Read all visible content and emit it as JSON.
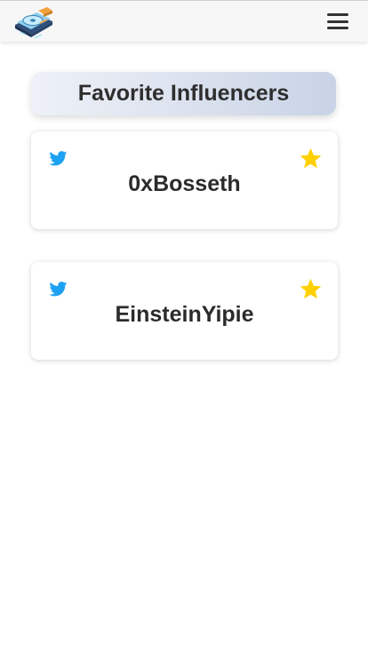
{
  "header": {
    "logo_icon": "harddrive-logo-icon",
    "menu_icon": "hamburger-menu-icon"
  },
  "main": {
    "title": "Favorite Influencers",
    "influencers": [
      {
        "handle": "0xBosseth",
        "platform_icon": "twitter-icon",
        "favorite": true
      },
      {
        "handle": "EinsteinYipie",
        "platform_icon": "twitter-icon",
        "favorite": true
      }
    ]
  },
  "colors": {
    "twitter_blue": "#1DA1F2",
    "star_gold": "#FFD000",
    "heading_gradient_start": "#eef1f7",
    "heading_gradient_end": "#c9d3e6",
    "text_dark": "#2b2b2b"
  }
}
